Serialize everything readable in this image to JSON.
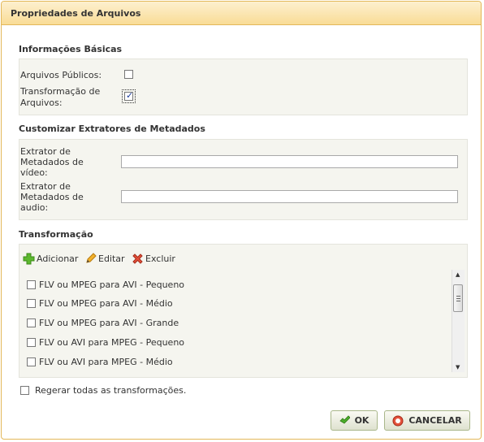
{
  "dialog": {
    "title": "Propriedades de Arquivos"
  },
  "basic": {
    "section_title": "Informações Básicas",
    "public_files_label": "Arquivos Públicos:",
    "public_files_checked": false,
    "transform_label_line1": "Transformação de",
    "transform_label_line2": "Arquivos:",
    "transform_checked": true
  },
  "extractors": {
    "section_title": "Customizar Extratores de Metadados",
    "video_label": [
      "Extrator de",
      "Metadados de",
      "vídeo:"
    ],
    "video_value": "",
    "audio_label": [
      "Extrator de",
      "Metadados de",
      "audio:"
    ],
    "audio_value": ""
  },
  "transformation": {
    "section_title": "Transformação",
    "toolbar": {
      "add": "Adicionar",
      "edit": "Editar",
      "delete": "Excluir"
    },
    "items": [
      {
        "label": "FLV ou MPEG para AVI - Pequeno",
        "checked": false
      },
      {
        "label": "FLV ou MPEG para AVI - Médio",
        "checked": false
      },
      {
        "label": "FLV ou MPEG para AVI - Grande",
        "checked": false
      },
      {
        "label": "FLV ou AVI para MPEG - Pequeno",
        "checked": false
      },
      {
        "label": "FLV ou AVI para MPEG - Médio",
        "checked": false
      }
    ]
  },
  "regenerate": {
    "label": "Regerar todas as transformações.",
    "checked": false
  },
  "buttons": {
    "ok": "OK",
    "cancel": "CANCELAR"
  },
  "colors": {
    "title_bar": "#f9dc96",
    "border": "#e3b85a",
    "panel": "#f5f5ef",
    "check": "#1a3a9c"
  }
}
